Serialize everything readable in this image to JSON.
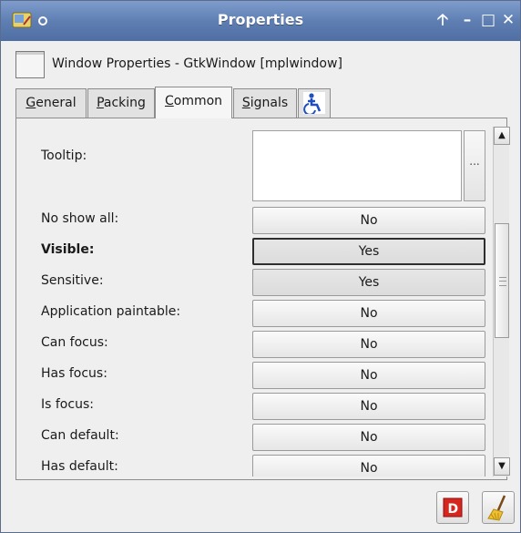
{
  "window": {
    "title": "Properties"
  },
  "titlebar_buttons": [
    {
      "glyph": "🡡",
      "name": "shade-button"
    },
    {
      "glyph": "–",
      "name": "minimize-button"
    },
    {
      "glyph": "□",
      "name": "maximize-button"
    },
    {
      "glyph": "✕",
      "name": "close-button"
    }
  ],
  "header": {
    "text": "Window Properties - GtkWindow [mplwindow]"
  },
  "tabs": [
    {
      "mnemonic": "G",
      "rest": "eneral"
    },
    {
      "mnemonic": "P",
      "rest": "acking"
    },
    {
      "mnemonic": "C",
      "rest": "ommon"
    },
    {
      "mnemonic": "S",
      "rest": "ignals"
    }
  ],
  "accessibility_tab": {
    "icon": "accessibility-icon"
  },
  "active_tab": "Common",
  "tooltip": {
    "label": "Tooltip:",
    "value": "",
    "more": "..."
  },
  "properties": [
    {
      "label": "No show all:",
      "value": "No"
    },
    {
      "label": "Visible:",
      "value": "Yes"
    },
    {
      "label": "Sensitive:",
      "value": "Yes"
    },
    {
      "label": "Application paintable:",
      "value": "No"
    },
    {
      "label": "Can focus:",
      "value": "No"
    },
    {
      "label": "Has focus:",
      "value": "No"
    },
    {
      "label": "Is focus:",
      "value": "No"
    },
    {
      "label": "Can default:",
      "value": "No"
    },
    {
      "label": "Has default:",
      "value": "No"
    }
  ],
  "scrollbar": {
    "up": "▲",
    "down": "▼"
  },
  "bottom_buttons": [
    {
      "icon": "red-d-icon",
      "letter": "D"
    },
    {
      "icon": "broom-icon"
    }
  ],
  "colors": {
    "titlebar": "#5f7fb3",
    "window_bg": "#efefef",
    "red_icon": "#d7261e"
  }
}
